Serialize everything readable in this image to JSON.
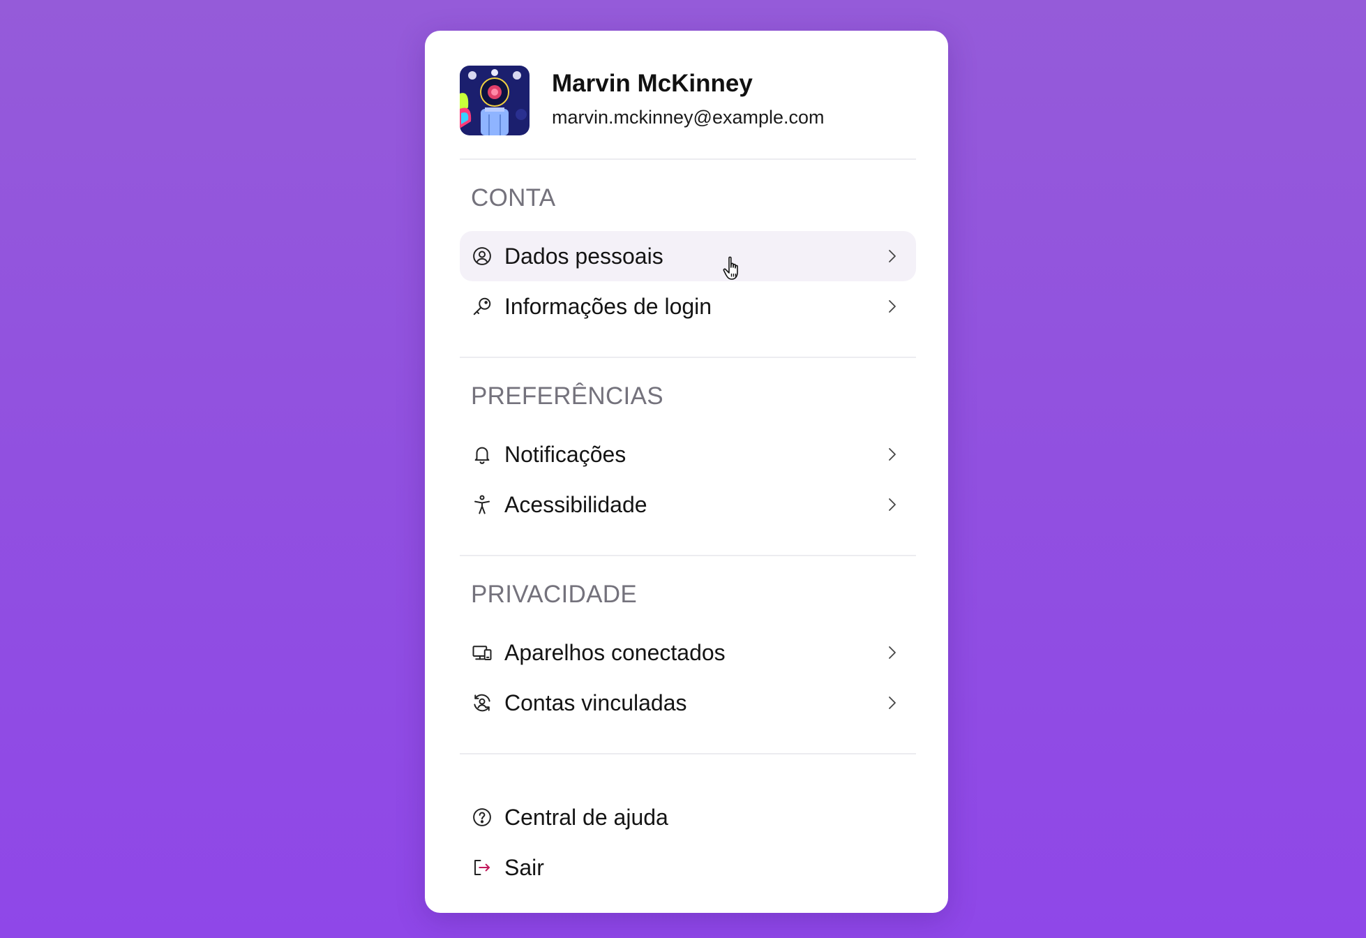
{
  "profile": {
    "name": "Marvin McKinney",
    "email": "marvin.mckinney@example.com"
  },
  "sections": [
    {
      "title": "CONTA",
      "items": [
        {
          "label": "Dados pessoais",
          "icon": "user-circle-icon"
        },
        {
          "label": "Informações de login",
          "icon": "key-icon"
        }
      ]
    },
    {
      "title": "PREFERÊNCIAS",
      "items": [
        {
          "label": "Notificações",
          "icon": "bell-icon"
        },
        {
          "label": "Acessibilidade",
          "icon": "accessibility-icon"
        }
      ]
    },
    {
      "title": "PRIVACIDADE",
      "items": [
        {
          "label": "Aparelhos conectados",
          "icon": "devices-icon"
        },
        {
          "label": "Contas vinculadas",
          "icon": "linked-accounts-icon"
        }
      ]
    }
  ],
  "footer": [
    {
      "label": "Central de ajuda",
      "icon": "help-circle-icon"
    },
    {
      "label": "Sair",
      "icon": "logout-icon"
    }
  ],
  "colors": {
    "background_top": "#955bd9",
    "background_bottom": "#8f47e8",
    "hover": "#f4f1f8",
    "logout_accent": "#c2185b"
  },
  "state": {
    "hovered_item": "Dados pessoais"
  }
}
